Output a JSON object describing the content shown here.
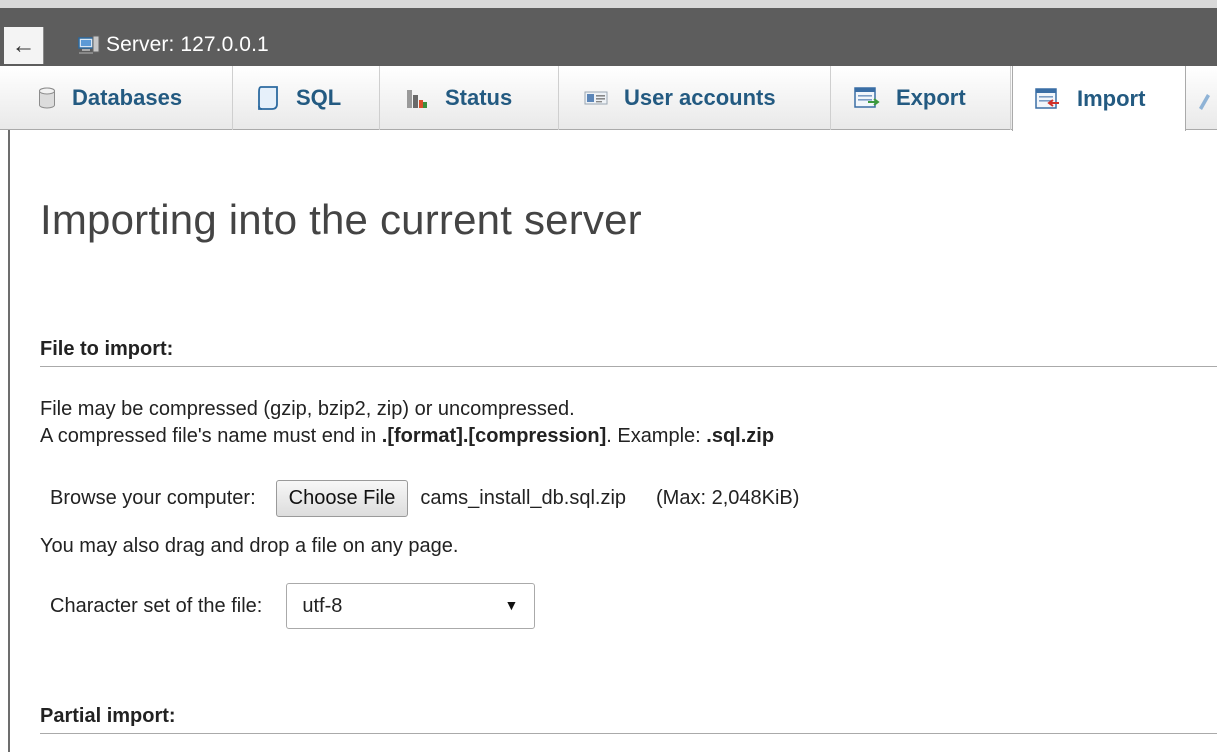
{
  "topbar": {
    "back_icon": "←",
    "server_label": "Server: 127.0.0.1"
  },
  "tabs": [
    {
      "label": "Databases",
      "icon": "database-icon"
    },
    {
      "label": "SQL",
      "icon": "sql-scroll-icon"
    },
    {
      "label": "Status",
      "icon": "status-chart-icon"
    },
    {
      "label": "User accounts",
      "icon": "user-accounts-icon"
    },
    {
      "label": "Export",
      "icon": "export-icon"
    },
    {
      "label": "Import",
      "icon": "import-icon",
      "active": true
    },
    {
      "label": "",
      "icon": "more-tab-icon"
    }
  ],
  "main": {
    "title": "Importing into the current server",
    "file_section": {
      "heading": "File to import:",
      "line1": "File may be compressed (gzip, bzip2, zip) or uncompressed.",
      "line2_prefix": "A compressed file's name must end in ",
      "line2_format": ".[format].[compression]",
      "line2_mid": ". Example: ",
      "line2_example": ".sql.zip",
      "browse_label": "Browse your computer:",
      "choose_button": "Choose File",
      "file_name": "cams_install_db.sql.zip",
      "max_size": "(Max: 2,048KiB)",
      "drag_note": "You may also drag and drop a file on any page.",
      "charset_label": "Character set of the file:",
      "charset_value": "utf-8",
      "charset_arrow": "▼"
    },
    "partial_section": {
      "heading": "Partial import:"
    }
  },
  "colors": {
    "topbar": "#5d5d5d",
    "tab_link": "#235a81",
    "heading": "#222222"
  }
}
